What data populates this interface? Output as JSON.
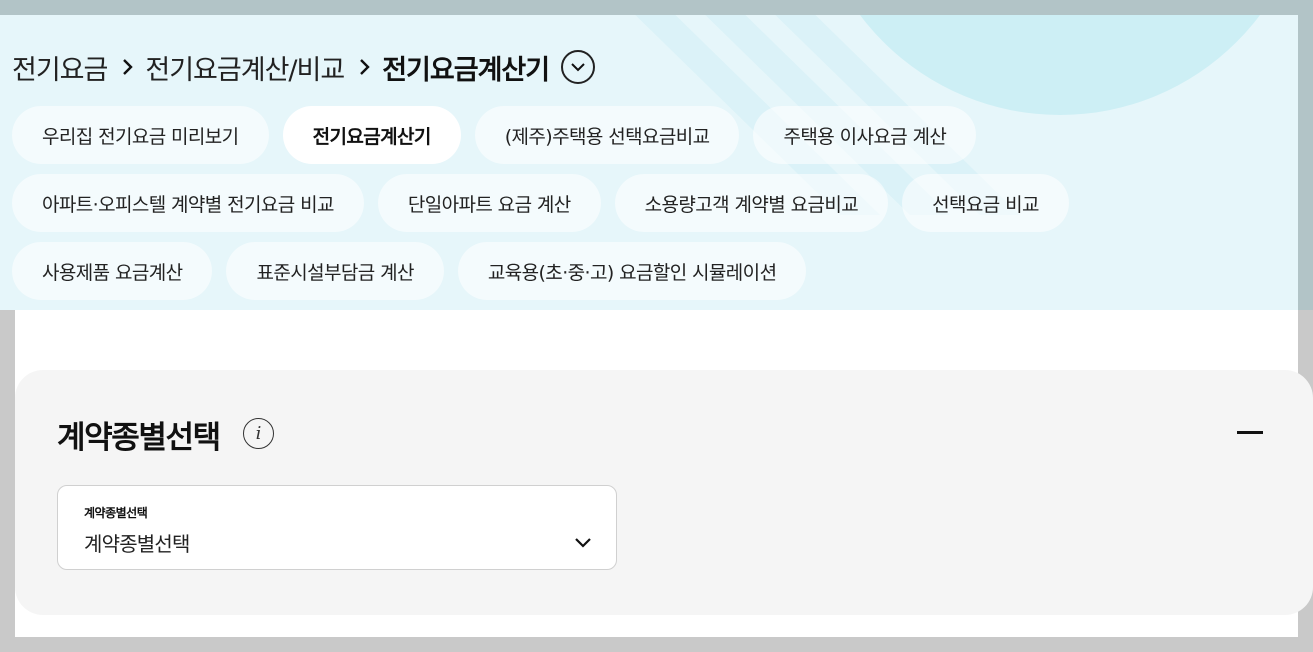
{
  "breadcrumb": {
    "items": [
      "전기요금",
      "전기요금계산/비교",
      "전기요금계산기"
    ]
  },
  "tabs": {
    "rows": [
      [
        {
          "label": "우리집 전기요금 미리보기",
          "active": false
        },
        {
          "label": "전기요금계산기",
          "active": true
        },
        {
          "label": "(제주)주택용 선택요금비교",
          "active": false
        },
        {
          "label": "주택용 이사요금 계산",
          "active": false
        }
      ],
      [
        {
          "label": "아파트·오피스텔 계약별 전기요금 비교",
          "active": false
        },
        {
          "label": "단일아파트 요금 계산",
          "active": false
        },
        {
          "label": "소용량고객 계약별 요금비교",
          "active": false
        },
        {
          "label": "선택요금 비교",
          "active": false
        }
      ],
      [
        {
          "label": "사용제품 요금계산",
          "active": false
        },
        {
          "label": "표준시설부담금 계산",
          "active": false
        },
        {
          "label": "교육용(초·중·고) 요금할인 시뮬레이션",
          "active": false
        }
      ]
    ]
  },
  "contract_section": {
    "title": "계약종별선택",
    "info_icon": "info-icon",
    "collapse_icon": "minus-icon",
    "select": {
      "label": "계약종별선택",
      "value": "계약종별선택"
    }
  },
  "colors": {
    "hero_bg": "#e6f6fa",
    "card_bg": "#f5f5f5",
    "text": "#222222"
  }
}
